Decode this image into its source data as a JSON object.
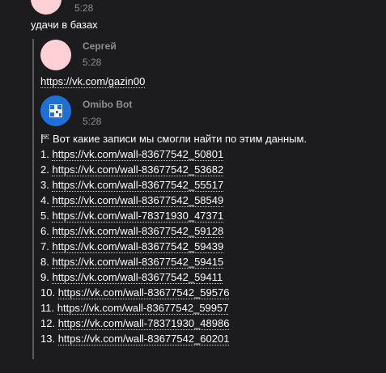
{
  "messages": [
    {
      "time": "5:28",
      "text": "удачи в базах",
      "avatar_color": "#ffd1d6"
    },
    {
      "author": "Сергей",
      "time": "5:28",
      "link": "https://vk.com/gazin00",
      "avatar_color": "#ffd1d6"
    },
    {
      "author": "Omibo Bot",
      "time": "5:28",
      "avatar_color": "#1f6fd6",
      "intro_icon": "flag-icon",
      "intro": "Вот какие записи мы смогли найти по этим данным.",
      "results": [
        {
          "num": "1.",
          "url": "https://vk.com/wall-83677542_50801"
        },
        {
          "num": "2.",
          "url": "https://vk.com/wall-83677542_53682"
        },
        {
          "num": "3.",
          "url": "https://vk.com/wall-83677542_55517"
        },
        {
          "num": "4.",
          "url": "https://vk.com/wall-83677542_58549"
        },
        {
          "num": "5.",
          "url": "https://vk.com/wall-78371930_47371"
        },
        {
          "num": "6.",
          "url": "https://vk.com/wall-83677542_59128"
        },
        {
          "num": "7.",
          "url": "https://vk.com/wall-83677542_59439"
        },
        {
          "num": "8.",
          "url": "https://vk.com/wall-83677542_59415"
        },
        {
          "num": "9.",
          "url": "https://vk.com/wall-83677542_59411"
        },
        {
          "num": "10.",
          "url": "https://vk.com/wall-83677542_59576"
        },
        {
          "num": "11.",
          "url": "https://vk.com/wall-83677542_59957"
        },
        {
          "num": "12.",
          "url": "https://vk.com/wall-78371930_48986"
        },
        {
          "num": "13.",
          "url": "https://vk.com/wall-83677542_60201"
        }
      ]
    }
  ]
}
